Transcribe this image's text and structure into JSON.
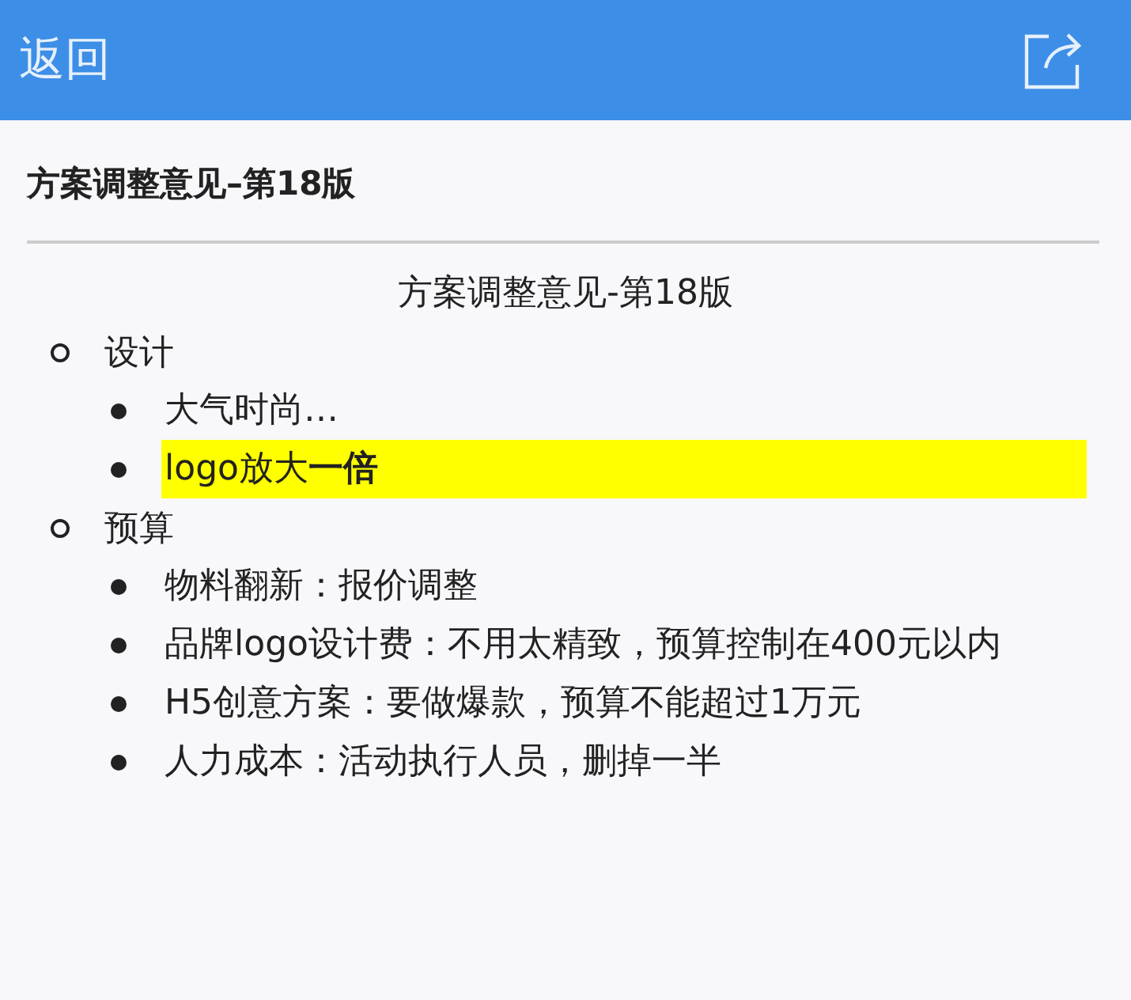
{
  "header": {
    "back": "返回"
  },
  "title": "方案调整意见–第18版",
  "document": {
    "heading": "方案调整意见-第18版",
    "sections": [
      {
        "label": "设计",
        "items": [
          {
            "text": "大气时尚…",
            "highlighted": false
          },
          {
            "text": "logo放大**一倍**",
            "highlighted": true
          }
        ]
      },
      {
        "label": "预算",
        "items": [
          {
            "text": "物料翻新：报价调整",
            "highlighted": false
          },
          {
            "text": "品牌logo设计费：不用太精致，预算控制在400元以内",
            "highlighted": false
          },
          {
            "text": "H5创意方案：要做爆款，预算不能超过1万元",
            "highlighted": false
          },
          {
            "text": "人力成本：活动执行人员，删掉一半",
            "highlighted": false
          }
        ]
      }
    ]
  }
}
